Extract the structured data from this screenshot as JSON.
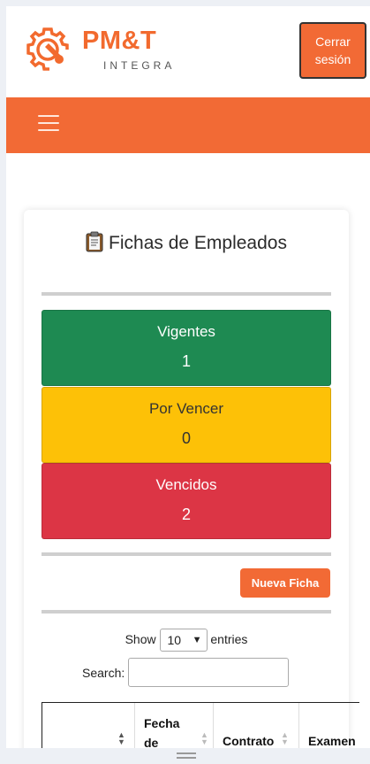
{
  "header": {
    "logo_title": "PM&T",
    "logo_subtitle": "INTEGRA",
    "logout_label": "Cerrar sesión"
  },
  "navbar": {
    "menu_icon": "hamburger-menu-icon"
  },
  "card": {
    "title": "Fichas de Empleados",
    "title_icon": "clipboard-icon"
  },
  "stats": [
    {
      "label": "Vigentes",
      "value": "1",
      "color": "#1e8a52"
    },
    {
      "label": "Por Vencer",
      "value": "0",
      "color": "#fdc107"
    },
    {
      "label": "Vencidos",
      "value": "2",
      "color": "#dc3545"
    }
  ],
  "new_button_label": "Nueva Ficha",
  "table_controls": {
    "show_label": "Show",
    "entries_value": "10",
    "entries_label": "entries",
    "search_label": "Search:",
    "search_value": ""
  },
  "table": {
    "columns": [
      "",
      "Fecha de",
      "Contrato",
      "Examen"
    ]
  },
  "colors": {
    "brand": "#f26a35"
  }
}
